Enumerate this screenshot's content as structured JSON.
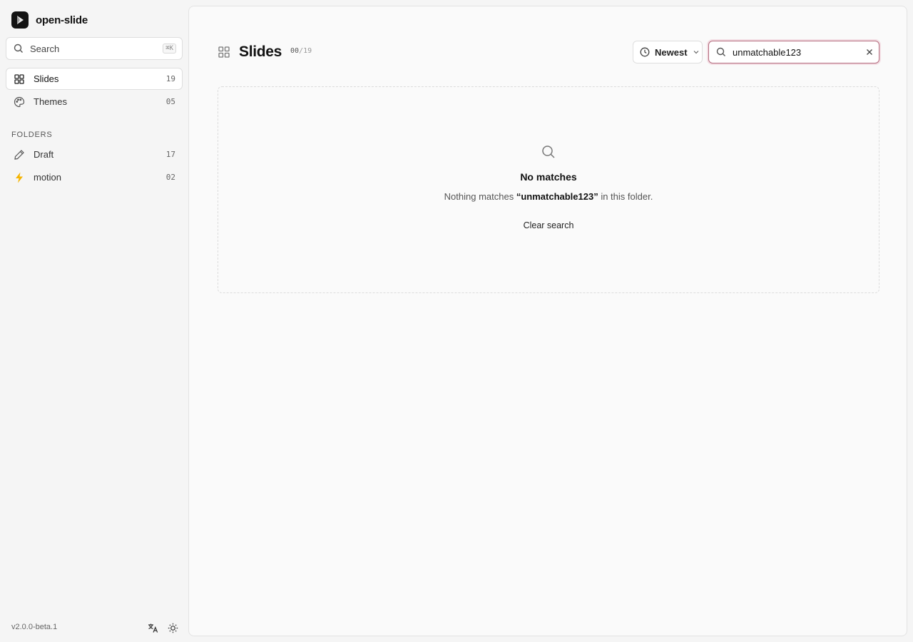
{
  "app": {
    "name": "open-slide",
    "version": "v2.0.0-beta.1"
  },
  "sidebar": {
    "search": {
      "label": "Search",
      "shortcut": "⌘K"
    },
    "nav": [
      {
        "label": "Slides",
        "count": "19",
        "icon": "grid-icon",
        "active": true
      },
      {
        "label": "Themes",
        "count": "05",
        "icon": "palette-icon",
        "active": false
      }
    ],
    "folders_label": "FOLDERS",
    "folders": [
      {
        "label": "Draft",
        "count": "17",
        "icon": "pencil-icon"
      },
      {
        "label": "motion",
        "count": "02",
        "icon": "lightning-icon"
      }
    ],
    "footer": {
      "translate_icon": "translate-icon",
      "theme_icon": "sun-icon"
    }
  },
  "main": {
    "title": "Slides",
    "count_current": "00",
    "count_total": "/19",
    "sort": {
      "label": "Newest"
    },
    "search": {
      "value": "unmatchable123"
    },
    "empty": {
      "title": "No matches",
      "desc_prefix": "Nothing matches ",
      "desc_query": "“unmatchable123”",
      "desc_suffix": " in this folder.",
      "clear_label": "Clear search"
    }
  },
  "colors": {
    "accent_focus": "#b36b7d",
    "lightning": "#f5b400"
  }
}
